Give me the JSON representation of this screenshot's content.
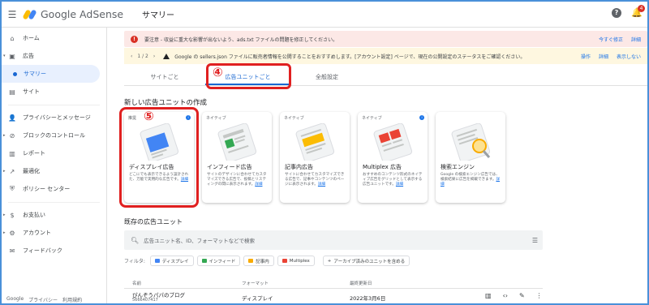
{
  "app": {
    "logo_text": "Google AdSense",
    "page_title": "サマリー",
    "notification_count": "4"
  },
  "sidebar": {
    "items": [
      {
        "label": "ホーム",
        "icon": "home-icon"
      },
      {
        "label": "広告",
        "icon": "ads-icon"
      },
      {
        "label": "サマリー",
        "icon": "dot-icon"
      },
      {
        "label": "サイト",
        "icon": "sites-icon"
      },
      {
        "label": "プライバシーとメッセージ",
        "icon": "privacy-icon"
      },
      {
        "label": "ブロックのコントロール",
        "icon": "block-icon"
      },
      {
        "label": "レポート",
        "icon": "report-icon"
      },
      {
        "label": "最適化",
        "icon": "optimize-icon"
      },
      {
        "label": "ポリシー センター",
        "icon": "shield-icon"
      },
      {
        "label": "お支払い",
        "icon": "payments-icon"
      },
      {
        "label": "アカウント",
        "icon": "gear-icon"
      },
      {
        "label": "フィードバック",
        "icon": "feedback-icon"
      }
    ],
    "footer": {
      "brand": "Google",
      "privacy": "プライバシー",
      "terms": "利用規約"
    }
  },
  "alerts": {
    "red": {
      "message": "要注意 - 収益に重大な影響が出ないよう、ads.txt ファイルの問題を修正してください。",
      "fix": "今すぐ修正",
      "details": "詳細"
    },
    "yellow": {
      "page": "1 / 2",
      "message": "Google の sellers.json ファイルに販売者情報を公開することをおすすめします。[アカウント設定] ページで、現在の公開設定のステータスをご確認ください。",
      "action": "操作",
      "details": "詳細",
      "dismiss": "表示しない"
    }
  },
  "tabs": [
    "サイトごと",
    "広告ユニットごと",
    "全般設定"
  ],
  "annotations": {
    "tab_marker": "④",
    "card_marker": "⑤"
  },
  "create_section": {
    "title": "新しい広告ユニットの作成",
    "link_label": "詳細",
    "cards": [
      {
        "chip": "推奨",
        "name": "ディスプレイ広告",
        "desc": "どこにでも表示できるよう設計された、万能で実用的な広告です。"
      },
      {
        "chip": "ネイティブ",
        "name": "インフィード広告",
        "desc": "サイトのデザインに合わせてカスタマイズできる広告で、投稿とリスティングの間に表示されます。"
      },
      {
        "chip": "ネイティブ",
        "name": "記事内広告",
        "desc": "サイトに合わせてカスタマイズできる広告で、記事やコンテンツのページに表示されます。"
      },
      {
        "chip": "ネイティブ",
        "name": "Multiplex 広告",
        "desc": "おすすめのコンテンツ形式のネイティブ広告をグリッドとして表示する広告ユニットです。"
      },
      {
        "chip": "",
        "name": "検索エンジン",
        "desc": "Google の検索エンジン広告では、検索結果に広告を掲載できます。"
      }
    ]
  },
  "existing_section": {
    "title": "既存の広告ユニット",
    "search_placeholder": "広告ユニット名、ID、フォーマットなどで検索",
    "filter_label": "フィルタ:",
    "filters": [
      "ディスプレイ",
      "インフィード",
      "記事内",
      "Multiplex"
    ],
    "archive_label": "アーカイブ済みのユニットを含める",
    "columns": {
      "name": "名前",
      "format": "フォーマット",
      "updated": "最終更新日"
    },
    "rows": [
      {
        "name": "ぴんぞうパパのブログ",
        "id": "5666407417",
        "format": "ディスプレイ",
        "updated": "2022年3月6日"
      }
    ]
  },
  "colors": {
    "accent": "#1a73e8",
    "annotation_red": "#e02020",
    "alert_red_bg": "#fce8e6",
    "alert_yellow_bg": "#fef7e0"
  }
}
